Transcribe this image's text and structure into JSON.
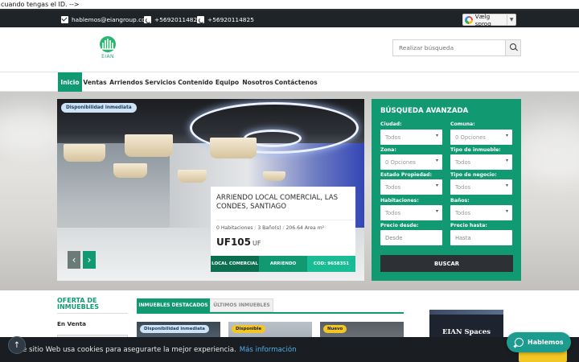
{
  "stray_text": "cuando tengas el ID. -->",
  "topbar": {
    "email": "hablemos@eiangroup.com",
    "phone1": "+56920114825",
    "phone2": "+56920114825",
    "language_label": "Vælg sprog"
  },
  "logo": {
    "text": "EIAN"
  },
  "search": {
    "placeholder": "Realizar búsqueda"
  },
  "nav": {
    "items": [
      {
        "label": "Inicio",
        "active": true
      },
      {
        "label": "Ventas"
      },
      {
        "label": "Arriendos"
      },
      {
        "label": "Servicios"
      },
      {
        "label": "Contenido"
      },
      {
        "label": "Equipo"
      },
      {
        "label": "Nosotros"
      },
      {
        "label": "Contáctenos"
      }
    ]
  },
  "slider": {
    "badge": "Disponibilidad inmediata",
    "title": "ARRIENDO LOCAL COMERCIAL, LAS CONDES, SANTIAGO",
    "habitaciones": "0 Habitaciones",
    "banos": "3 Baño(s)",
    "area": "206.64 Area m²",
    "price": "UF105",
    "price_unit": "UF",
    "tags": [
      {
        "label": "LOCAL COMERCIAL",
        "color": "#0c6f4f"
      },
      {
        "label": "ARRIENDO",
        "color": "#119a72"
      },
      {
        "label": "COD: 9658351",
        "color": "#19bc94"
      }
    ],
    "prev_arrow": "‹",
    "next_arrow": "›"
  },
  "advanced_search": {
    "title": "BÚSQUEDA AVANZADA",
    "fields": [
      {
        "label": "Ciudad:",
        "value": "Todos"
      },
      {
        "label": "Comuna:",
        "value": "0 Opciones"
      },
      {
        "label": "Zona:",
        "value": "0 Opciones"
      },
      {
        "label": "Tipo de inmueble:",
        "value": "Todos"
      },
      {
        "label": "Estado Propiedad:",
        "value": "Todos"
      },
      {
        "label": "Tipo de negocio:",
        "value": "Todos"
      },
      {
        "label": "Habitaciones:",
        "value": "Todos"
      },
      {
        "label": "Baños:",
        "value": "Todos"
      }
    ],
    "precio_desde_label": "Precio desde:",
    "precio_desde_placeholder": "Desde",
    "precio_hasta_label": "Precio hasta:",
    "precio_hasta_placeholder": "Hasta",
    "button": "BUSCAR"
  },
  "oferta": {
    "title": "OFERTA DE INMUEBLES",
    "en_venta": "En Venta"
  },
  "tabs": [
    {
      "label": "INMUEBLES DESTACADOS",
      "active": true
    },
    {
      "label": "ÚLTIMOS INMUEBLES",
      "active": false
    }
  ],
  "cards": [
    {
      "badge": "Disponibilidad inmediata",
      "badge_bg": "#cfe3f7",
      "badge_color": "#1c3c5a"
    },
    {
      "badge": "Disponible",
      "badge_bg": "#f2c623",
      "badge_color": "#222222"
    },
    {
      "badge": "Nuevo",
      "badge_bg": "#f2c623",
      "badge_color": "#222222"
    }
  ],
  "eian_spaces": "EIAN Spaces",
  "cookie": {
    "text": "e sitio Web usa cookies para asegurarte la mejor experiencia.",
    "link": "Más información"
  },
  "whatsapp": {
    "label": "Hablemos"
  },
  "colors": {
    "accent": "#119a72",
    "dark": "#1f2428",
    "link": "#4fb1e8"
  }
}
